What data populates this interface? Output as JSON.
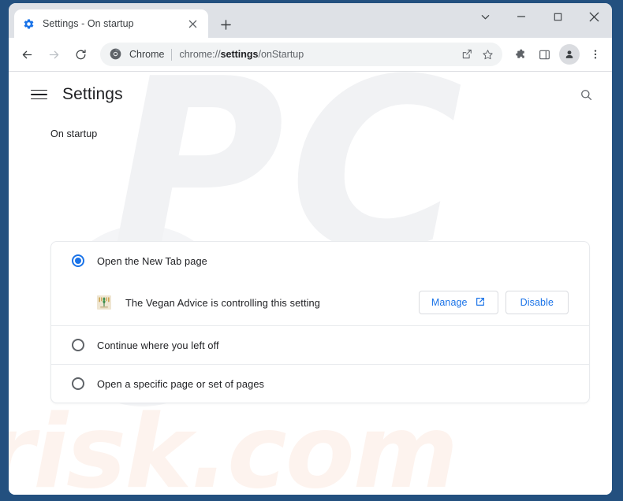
{
  "window": {
    "frame_color": "#23507f",
    "controls": {
      "expand_label": "⌄",
      "minimize_label": "─",
      "maximize_label": "□",
      "close_label": "✕"
    }
  },
  "tab_strip": {
    "active_tab": {
      "favicon": "settings-gear-icon",
      "title": "Settings - On startup",
      "close_label": "✕"
    },
    "new_tab_label": "+"
  },
  "toolbar": {
    "back_icon": "back-arrow-icon",
    "forward_icon": "forward-arrow-icon",
    "reload_icon": "reload-icon",
    "omnibox": {
      "site_icon": "chrome-logo-icon",
      "scheme_label": "Chrome",
      "url_prefix": "chrome://",
      "url_bold": "settings",
      "url_suffix": "/onStartup",
      "share_icon": "share-icon",
      "bookmark_icon": "bookmark-star-icon"
    },
    "extensions_icon": "extensions-puzzle-icon",
    "side_panel_icon": "side-panel-icon",
    "profile_icon": "profile-avatar-icon",
    "menu_icon": "three-dot-menu-icon"
  },
  "settings": {
    "menu_icon": "hamburger-menu-icon",
    "title": "Settings",
    "search_icon": "search-icon",
    "section_label": "On startup",
    "options": [
      {
        "label": "Open the New Tab page",
        "checked": true
      },
      {
        "label": "Continue where you left off",
        "checked": false
      },
      {
        "label": "Open a specific page or set of pages",
        "checked": false
      }
    ],
    "controlled_by": {
      "extension_icon": "vegan-advice-extension-icon",
      "text": "The Vegan Advice is controlling this setting",
      "manage_label": "Manage",
      "manage_icon": "external-link-icon",
      "disable_label": "Disable"
    }
  },
  "watermark": {
    "initials": "PC",
    "domain": "risk.com",
    "initials_color": "#f1f2f4",
    "domain_color": "#fdf3ee"
  },
  "colors": {
    "accent_blue": "#1a73e8",
    "tab_strip": "#dee1e6",
    "omnibox_bg": "#f1f3f4",
    "text_primary": "#202124",
    "text_secondary": "#5f6368",
    "card_border": "#e8eaed"
  }
}
